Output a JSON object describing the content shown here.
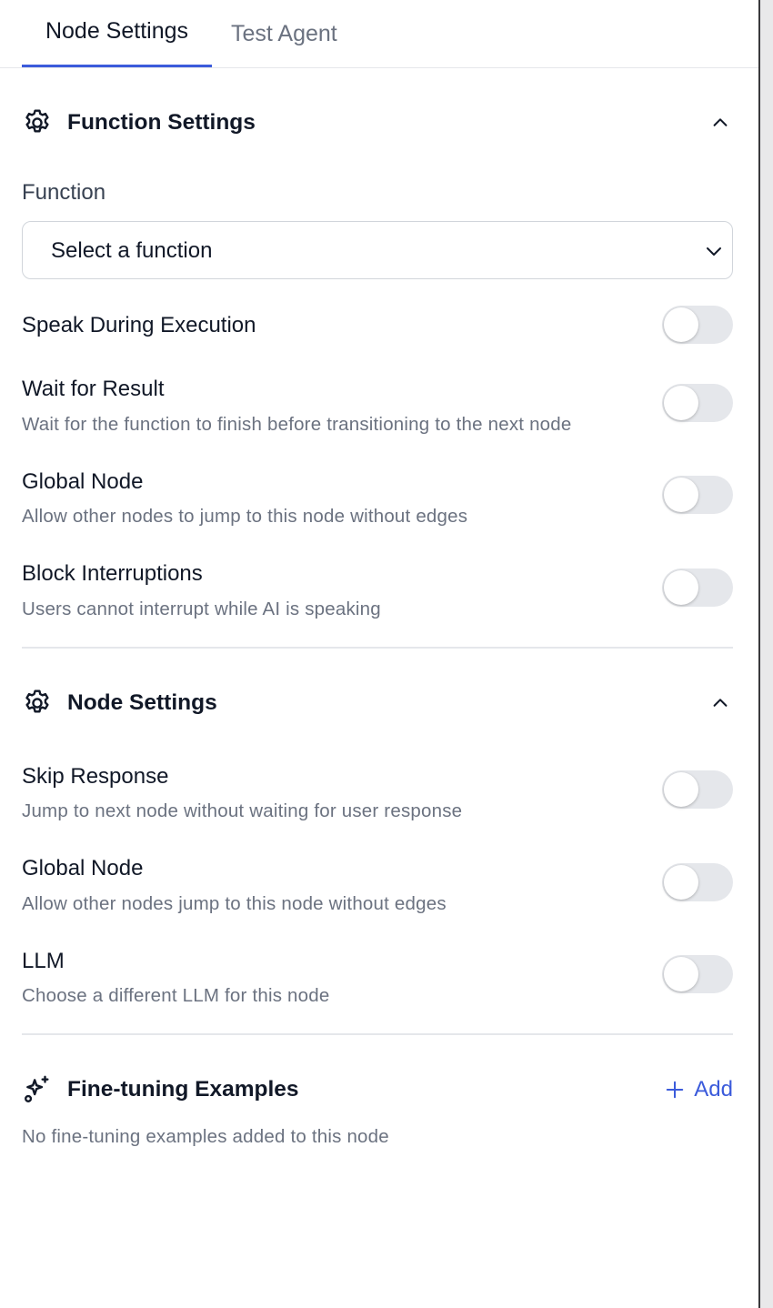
{
  "tabs": {
    "node_settings": "Node Settings",
    "test_agent": "Test Agent"
  },
  "function_settings": {
    "title": "Function Settings",
    "function_label": "Function",
    "function_select_value": "Select a function",
    "rows": [
      {
        "title": "Speak During Execution",
        "description": "",
        "enabled": false
      },
      {
        "title": "Wait for Result",
        "description": "Wait for the function to finish before transitioning to the next node",
        "enabled": false
      },
      {
        "title": "Global Node",
        "description": "Allow other nodes to jump to this node without edges",
        "enabled": false
      },
      {
        "title": "Block Interruptions",
        "description": "Users cannot interrupt while AI is speaking",
        "enabled": false
      }
    ]
  },
  "node_settings": {
    "title": "Node Settings",
    "rows": [
      {
        "title": "Skip Response",
        "description": "Jump to next node without waiting for user response",
        "enabled": false
      },
      {
        "title": "Global Node",
        "description": "Allow other nodes jump to this node without edges",
        "enabled": false
      },
      {
        "title": "LLM",
        "description": "Choose a different LLM for this node",
        "enabled": false
      }
    ]
  },
  "fine_tuning": {
    "title": "Fine-tuning Examples",
    "add_label": "Add",
    "empty_text": "No fine-tuning examples added to this node"
  },
  "colors": {
    "accent": "#3b5bdb",
    "toggle_off": "#e5e7eb",
    "muted_text": "#6b7280"
  },
  "icons": {
    "section": "gear-icon",
    "collapse": "chevron-up-icon",
    "select": "chevron-down-icon",
    "fine_tuning": "sparkles-icon",
    "add": "plus-icon"
  }
}
